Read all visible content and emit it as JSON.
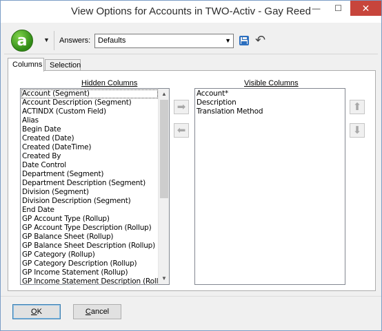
{
  "window": {
    "title": "View Options for Accounts in TWO-Activ - Gay Reed",
    "minimize_glyph": "—",
    "maximize_glyph": "☐",
    "close_glyph": "✕"
  },
  "toolbar": {
    "logo_letter": "a",
    "logo_icon": "activant-logo-icon",
    "dropdown_glyph": "▼",
    "answers_label": "Answers:",
    "answers_value": "Defaults",
    "answers_arrow": "▼",
    "save_icon": "save-icon",
    "undo_glyph": "↶"
  },
  "tabs": [
    {
      "label": "Columns",
      "active": true
    },
    {
      "label": "Selection",
      "active": false
    }
  ],
  "hidden_columns": {
    "header": "Hidden Columns",
    "items": [
      "Account (Segment)",
      "Account Description (Segment)",
      "ACTINDX (Custom Field)",
      "Alias",
      "Begin Date",
      "Created (Date)",
      "Created (DateTime)",
      "Created By",
      "Date Control",
      "Department (Segment)",
      "Department Description (Segment)",
      "Division (Segment)",
      "Division Description (Segment)",
      "End Date",
      "GP Account Type (Rollup)",
      "GP Account Type Description (Rollup)",
      "GP Balance Sheet (Rollup)",
      "GP Balance Sheet Description (Rollup)",
      "GP Category (Rollup)",
      "GP Category Description (Rollup)",
      "GP Income Statement (Rollup)",
      "GP Income Statement Description (Rollup)"
    ],
    "selected_index": 0
  },
  "visible_columns": {
    "header": "Visible Columns",
    "items": [
      "Account*",
      "Description",
      "Translation Method"
    ]
  },
  "buttons": {
    "add_glyph": "➡",
    "remove_glyph": "⬅",
    "up_glyph": "⬆",
    "down_glyph": "⬇",
    "ok_prefix": "",
    "ok_underlined": "O",
    "ok_rest": "K",
    "cancel_underlined": "C",
    "cancel_rest": "ancel"
  },
  "scrollbar": {
    "up_glyph": "▲",
    "down_glyph": "▼"
  },
  "colors": {
    "close_button": "#c7453c",
    "logo_green": "#2f8a16",
    "accent_blue": "#2c6fbf"
  }
}
